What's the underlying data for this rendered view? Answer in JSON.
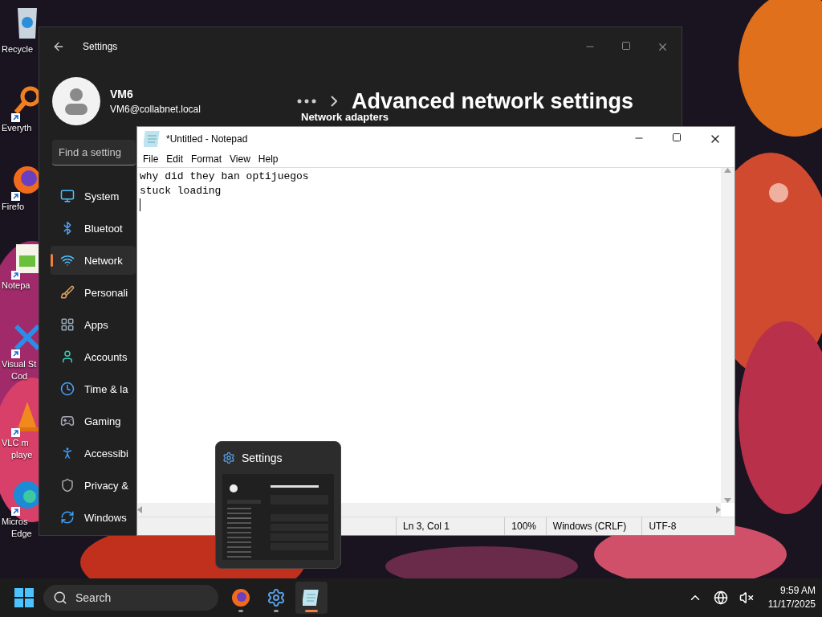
{
  "desktop_icons": [
    {
      "lines": [
        "Recycle"
      ],
      "shortcut": false
    },
    {
      "lines": [
        "Everyth"
      ],
      "shortcut": true
    },
    {
      "lines": [
        "Firefo"
      ],
      "shortcut": true
    },
    {
      "lines": [
        "Notepa"
      ],
      "shortcut": true
    },
    {
      "lines": [
        "Visual St",
        "Cod"
      ],
      "shortcut": true
    },
    {
      "lines": [
        "VLC m",
        "playe"
      ],
      "shortcut": true
    },
    {
      "lines": [
        "Micros",
        "Edge"
      ],
      "shortcut": true
    }
  ],
  "settings_window": {
    "title": "Settings",
    "user": {
      "name": "VM6",
      "email": "VM6@collabnet.local"
    },
    "search": {
      "placeholder": "Find a setting"
    },
    "nav": [
      {
        "label": "System",
        "selected": false
      },
      {
        "label": "Bluetoot",
        "selected": false
      },
      {
        "label": "Network",
        "selected": true
      },
      {
        "label": "Personali",
        "selected": false
      },
      {
        "label": "Apps",
        "selected": false
      },
      {
        "label": "Accounts",
        "selected": false
      },
      {
        "label": "Time & la",
        "selected": false
      },
      {
        "label": "Gaming",
        "selected": false
      },
      {
        "label": "Accessibi",
        "selected": false
      },
      {
        "label": "Privacy &",
        "selected": false
      },
      {
        "label": "Windows",
        "selected": false
      }
    ],
    "page_title": "Advanced network settings",
    "section": "Network adapters"
  },
  "notepad": {
    "title": "*Untitled - Notepad",
    "menu": [
      "File",
      "Edit",
      "Format",
      "View",
      "Help"
    ],
    "lines": [
      "why did they ban optijuegos",
      "stuck loading"
    ],
    "status_bar": [
      "Ln 3, Col 1",
      "100%",
      "Windows (CRLF)",
      "UTF-8"
    ]
  },
  "task_preview": {
    "title": "Settings"
  },
  "taskbar": {
    "search": {
      "label": "Search"
    },
    "apps": [
      {
        "kind": "firefox",
        "selected": false
      },
      {
        "kind": "settings",
        "selected": false
      },
      {
        "kind": "notepad",
        "selected": true
      }
    ],
    "time": "9:59 AM",
    "date": "11/17/2025"
  }
}
